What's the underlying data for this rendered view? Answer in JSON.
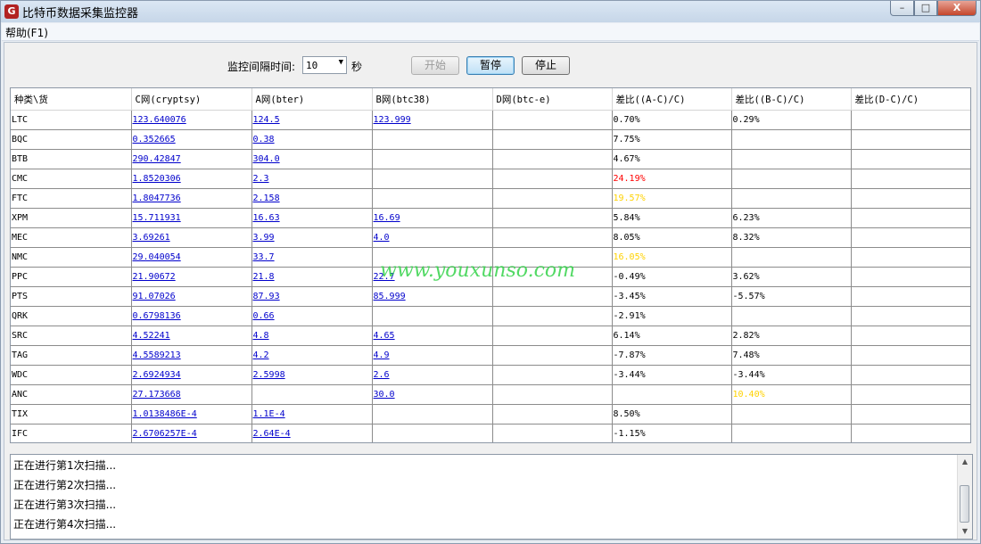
{
  "window": {
    "title": "比特币数据采集监控器",
    "icon_letter": "G"
  },
  "caption": {
    "minimize": "–",
    "maximize": "□",
    "close": "X"
  },
  "menu": {
    "help": "帮助(F1)"
  },
  "controls": {
    "interval_label": "监控间隔时间:",
    "interval_value": "10",
    "interval_unit": "秒",
    "start_label": "开始",
    "pause_label": "暂停",
    "stop_label": "停止"
  },
  "table": {
    "headers": [
      "种类\\货",
      "C网(cryptsy)",
      "A网(bter)",
      "B网(btc38)",
      "D网(btc-e)",
      "差比((A-C)/C)",
      "差比((B-C)/C)",
      "差比(D-C)/C)"
    ],
    "rows": [
      [
        "LTC",
        "123.640076",
        "124.5",
        "123.999",
        "",
        "0.70%",
        "0.29%",
        ""
      ],
      [
        "BQC",
        "0.352665",
        "0.38",
        "",
        "",
        "7.75%",
        "",
        ""
      ],
      [
        "BTB",
        "290.42847",
        "304.0",
        "",
        "",
        "4.67%",
        "",
        ""
      ],
      [
        "CMC",
        "1.8520306",
        "2.3",
        "",
        "",
        "24.19%",
        "",
        ""
      ],
      [
        "FTC",
        "1.8047736",
        "2.158",
        "",
        "",
        "19.57%",
        "",
        ""
      ],
      [
        "XPM",
        "15.711931",
        "16.63",
        "16.69",
        "",
        "5.84%",
        "6.23%",
        ""
      ],
      [
        "MEC",
        "3.69261",
        "3.99",
        "4.0",
        "",
        "8.05%",
        "8.32%",
        ""
      ],
      [
        "NMC",
        "29.040054",
        "33.7",
        "",
        "",
        "16.05%",
        "",
        ""
      ],
      [
        "PPC",
        "21.90672",
        "21.8",
        "22.7",
        "",
        "-0.49%",
        "3.62%",
        ""
      ],
      [
        "PTS",
        "91.07026",
        "87.93",
        "85.999",
        "",
        "-3.45%",
        "-5.57%",
        ""
      ],
      [
        "QRK",
        "0.6798136",
        "0.66",
        "",
        "",
        "-2.91%",
        "",
        ""
      ],
      [
        "SRC",
        "4.52241",
        "4.8",
        "4.65",
        "",
        "6.14%",
        "2.82%",
        ""
      ],
      [
        "TAG",
        "4.5589213",
        "4.2",
        "4.9",
        "",
        "-7.87%",
        "7.48%",
        ""
      ],
      [
        "WDC",
        "2.6924934",
        "2.5998",
        "2.6",
        "",
        "-3.44%",
        "-3.44%",
        ""
      ],
      [
        "ANC",
        "27.173668",
        "",
        "30.0",
        "",
        "",
        "10.40%",
        ""
      ],
      [
        "TIX",
        "1.0138486E-4",
        "1.1E-4",
        "",
        "",
        "8.50%",
        "",
        ""
      ],
      [
        "IFC",
        "2.6706257E-4",
        "2.64E-4",
        "",
        "",
        "-1.15%",
        "",
        ""
      ]
    ],
    "highlight_colors": {
      "red": "#ff0000",
      "yellow": "#ffd200"
    },
    "cell_styles": {
      "3.5": "red",
      "4.5": "yellow",
      "7.5": "yellow",
      "14.6": "yellow"
    }
  },
  "watermark": "www.youxunso.com",
  "log": {
    "lines": [
      "正在进行第1次扫描...",
      "正在进行第2次扫描...",
      "正在进行第3次扫描...",
      "正在进行第4次扫描..."
    ]
  },
  "colors": {
    "link": "#0000cc",
    "watermark": "#34d34a"
  }
}
